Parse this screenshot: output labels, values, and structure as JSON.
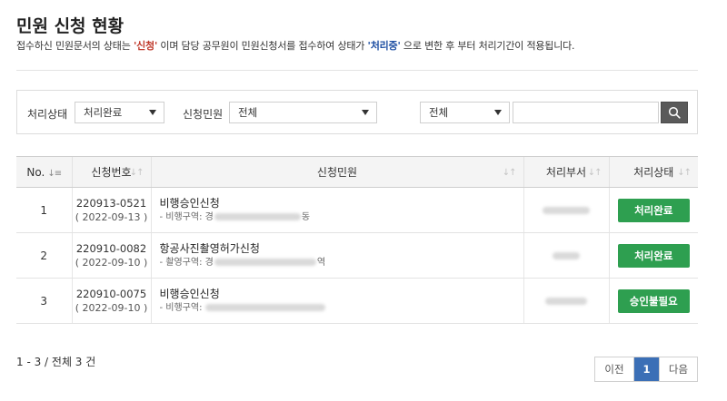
{
  "page": {
    "title": "민원 신청 현황",
    "notice": {
      "pre": "접수하신 민원문서의 상태는 ",
      "state1": "'신청'",
      "mid": " 이며 담당 공무원이 민원신청서를 접수하여 상태가 ",
      "state2": "'처리중'",
      "post": " 으로 변한 후 부터 처리기간이 적용됩니다."
    }
  },
  "colors": {
    "badge_green": "#2e9f50",
    "pager_active": "#3b6fb6",
    "notice_red": "#c0392b",
    "notice_blue": "#1e4fa3"
  },
  "filters": {
    "status_label": "처리상태",
    "status_value": "처리완료",
    "request_label": "신청민원",
    "request_value": "전체",
    "scope_value": "전체",
    "search_value": "",
    "search_icon": "search-icon"
  },
  "table": {
    "headers": {
      "no": "No.",
      "number": "신청번호",
      "request": "신청민원",
      "dept": "처리부서",
      "state": "처리상태"
    },
    "rows": [
      {
        "no": "1",
        "number": "220913-0521",
        "date": "( 2022-09-13 )",
        "title": "비행승인신청",
        "sub": "- 비행구역: 경",
        "sub_tail": "동",
        "state": "처리완료"
      },
      {
        "no": "2",
        "number": "220910-0082",
        "date": "( 2022-09-10 )",
        "title": "항공사진촬영허가신청",
        "sub": "- 촬영구역: 경",
        "sub_tail": "역",
        "state": "처리완료"
      },
      {
        "no": "3",
        "number": "220910-0075",
        "date": "( 2022-09-10 )",
        "title": "비행승인신청",
        "sub": "- 비행구역:",
        "sub_tail": "",
        "state": "승인불필요"
      }
    ]
  },
  "footer": {
    "count": "1 - 3 / 전체 3 건",
    "prev": "이전",
    "current_page": "1",
    "next": "다음"
  }
}
